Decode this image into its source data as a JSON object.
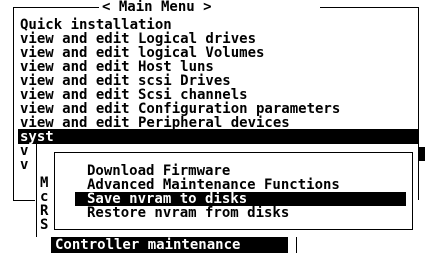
{
  "main_menu": {
    "title": "< Main Menu >",
    "items": [
      "Quick installation",
      "view and edit Logical drives",
      "view and edit logical Volumes",
      "view and edit Host luns",
      "view and edit scsi Drives",
      "view and edit Scsi channels",
      "view and edit Configuration parameters",
      "view and edit Peripheral devices",
      "syst",
      "v",
      "v"
    ]
  },
  "background_menu": {
    "letters": [
      "M",
      "c",
      "R",
      "S"
    ],
    "selected": "Controller maintenance"
  },
  "popup_menu": {
    "items": [
      "Download Firmware",
      "Advanced Maintenance Functions",
      "Save nvram to disks",
      "Restore nvram from disks"
    ]
  }
}
